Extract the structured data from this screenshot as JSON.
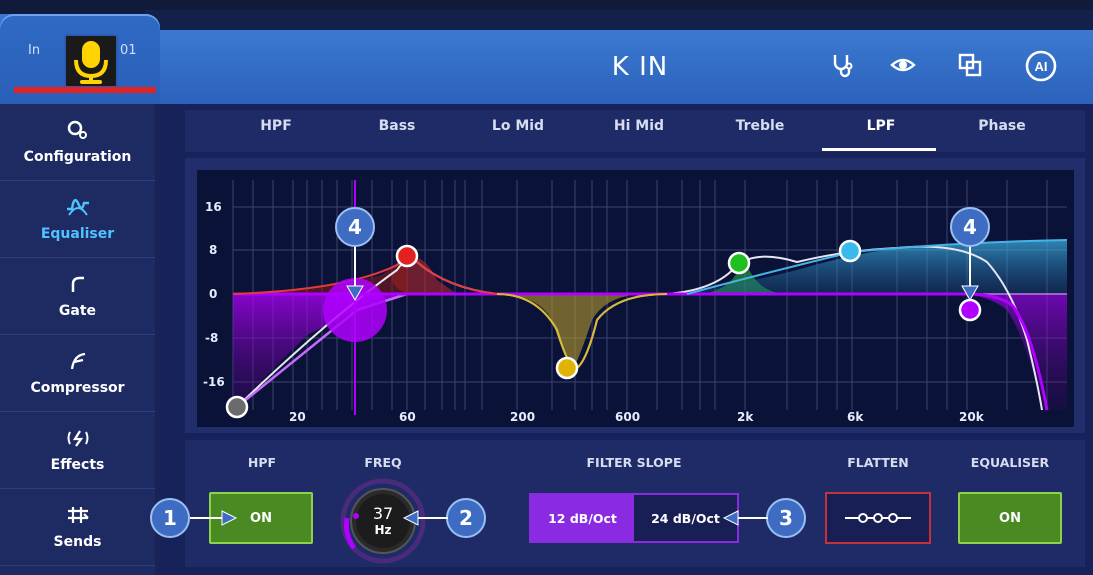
{
  "header": {
    "input_label": "In",
    "channel_number": "01",
    "title": "K IN",
    "icons": [
      "stethoscope-icon",
      "eye-icon",
      "copy-icon",
      "ai-icon"
    ],
    "ai_label": "AI",
    "accent_color": "#e02424"
  },
  "sidebar": {
    "items": [
      {
        "label": "Configuration",
        "icon": "configuration-icon"
      },
      {
        "label": "Equaliser",
        "icon": "equaliser-icon",
        "active": true
      },
      {
        "label": "Gate",
        "icon": "gate-icon"
      },
      {
        "label": "Compressor",
        "icon": "compressor-icon"
      },
      {
        "label": "Effects",
        "icon": "effects-icon"
      },
      {
        "label": "Sends",
        "icon": "sends-icon"
      }
    ]
  },
  "tabs": [
    "HPF",
    "Bass",
    "Lo Mid",
    "Hi Mid",
    "Treble",
    "LPF",
    "Phase"
  ],
  "active_tab": "LPF",
  "graph": {
    "y_ticks": [
      "16",
      "8",
      "0",
      "-8",
      "-16"
    ],
    "x_ticks": [
      "20",
      "60",
      "200",
      "600",
      "2k",
      "6k",
      "20k"
    ]
  },
  "controls": {
    "hpf_label": "HPF",
    "hpf_state": "ON",
    "freq_label": "FREQ",
    "freq_value": "37",
    "freq_unit": "Hz",
    "filter_slope_label": "FILTER SLOPE",
    "slope_options": [
      "12 dB/Oct",
      "24 dB/Oct"
    ],
    "slope_selected": "12 dB/Oct",
    "flatten_label": "FLATTEN",
    "equaliser_label": "EQUALISER",
    "equaliser_state": "ON"
  },
  "callouts": [
    "1",
    "2",
    "3",
    "4",
    "4"
  ],
  "colors": {
    "on_green": "#4a8a22",
    "slope_purple": "#8a2be2",
    "flatten_red": "#c5303a",
    "active_tab_text": "#4fc3ff"
  }
}
